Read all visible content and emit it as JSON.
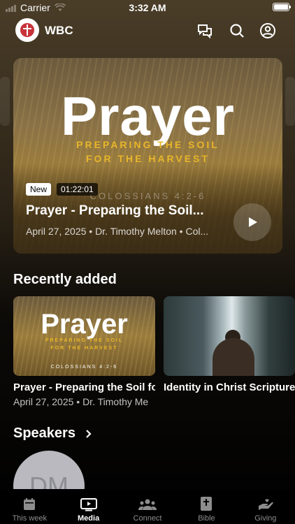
{
  "status_bar": {
    "carrier": "Carrier",
    "time": "3:32 AM"
  },
  "header": {
    "brand": "WBC"
  },
  "hero": {
    "art_title": "Prayer",
    "art_subtitle_line1": "PREPARING THE SOIL",
    "art_subtitle_line2": "FOR THE HARVEST",
    "art_reference": "COLOSSIANS 4:2-6",
    "badge_new": "New",
    "duration": "01:22:01",
    "title": "Prayer - Preparing the Soil...",
    "meta": "April 27, 2025 • Dr. Timothy Melton • Col..."
  },
  "recently_added": {
    "heading": "Recently added",
    "items": [
      {
        "art_title": "Prayer",
        "art_subtitle_line1": "PREPARING THE SOIL",
        "art_subtitle_line2": "FOR THE HARVEST",
        "art_reference": "COLOSSIANS 4:2-6",
        "title": "Prayer - Preparing the Soil fo",
        "meta": "April 27, 2025 • Dr. Timothy Me"
      },
      {
        "title": "Identity in Christ Scripture"
      }
    ]
  },
  "speakers": {
    "heading": "Speakers",
    "avatar_initials": "DM"
  },
  "tabbar": {
    "tabs": [
      {
        "label": "This week",
        "icon": "calendar-icon",
        "active": false
      },
      {
        "label": "Media",
        "icon": "play-screen-icon",
        "active": true
      },
      {
        "label": "Connect",
        "icon": "people-icon",
        "active": false
      },
      {
        "label": "Bible",
        "icon": "bible-icon",
        "active": false
      },
      {
        "label": "Giving",
        "icon": "giving-hand-icon",
        "active": false
      }
    ]
  },
  "colors": {
    "accent_gold": "#e8b62a",
    "tab_inactive": "#8d8d8d"
  }
}
